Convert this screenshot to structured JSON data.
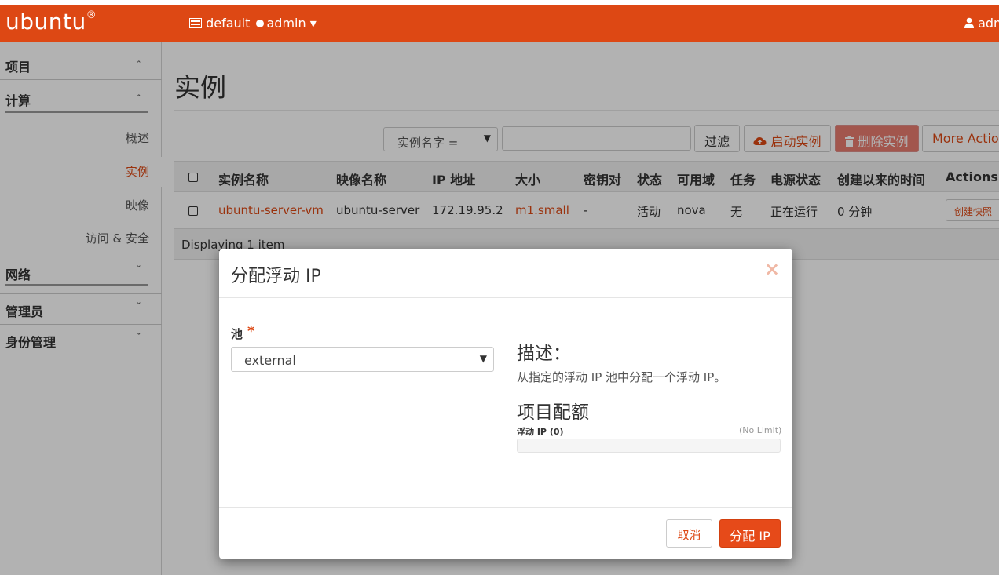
{
  "header": {
    "logo": "ubuntu",
    "logo_mark": "®",
    "context_domain": "default",
    "context_project": "admin",
    "context_caret": "▾",
    "user_label": "adm"
  },
  "sidebar": {
    "project": "项目",
    "compute": "计算",
    "items": [
      {
        "label": "概述"
      },
      {
        "label": "实例"
      },
      {
        "label": "映像"
      },
      {
        "label": "访问 & 安全"
      }
    ],
    "network": "网络",
    "admin": "管理员",
    "identity": "身份管理",
    "chev_up": "ˆ",
    "chev_down": "ˇ"
  },
  "page": {
    "title": "实例",
    "filter_select": "实例名字 =",
    "filter_input_value": "",
    "filter_button": "过滤",
    "launch_button": "启动实例",
    "delete_button": "删除实例",
    "more_button": "More Action"
  },
  "table": {
    "headers": [
      "实例名称",
      "映像名称",
      "IP 地址",
      "大小",
      "密钥对",
      "状态",
      "可用域",
      "任务",
      "电源状态",
      "创建以来的时间",
      "Actions"
    ],
    "rows": [
      {
        "name": "ubuntu-server-vm",
        "image": "ubuntu-server",
        "ip": "172.19.95.2",
        "size": "m1.small",
        "keypair": "-",
        "status": "活动",
        "az": "nova",
        "task": "无",
        "power": "正在运行",
        "age": "0 分钟",
        "action": "创建快照"
      }
    ],
    "footer": "Displaying 1 item"
  },
  "modal": {
    "title": "分配浮动 IP",
    "close": "×",
    "pool_label": "池",
    "required_mark": "*",
    "pool_value": "external",
    "select_arrow": "▼",
    "desc_heading": "描述：",
    "desc_text": "从指定的浮动 IP 池中分配一个浮动 IP。",
    "quota_heading": "项目配额",
    "quota_label": "浮动 IP (0)",
    "quota_limit": "(No Limit)",
    "quota_used_fraction": 0,
    "cancel": "取消",
    "submit": "分配 IP"
  },
  "colors": {
    "brand": "#dd4814",
    "danger": "#e87c6f"
  }
}
